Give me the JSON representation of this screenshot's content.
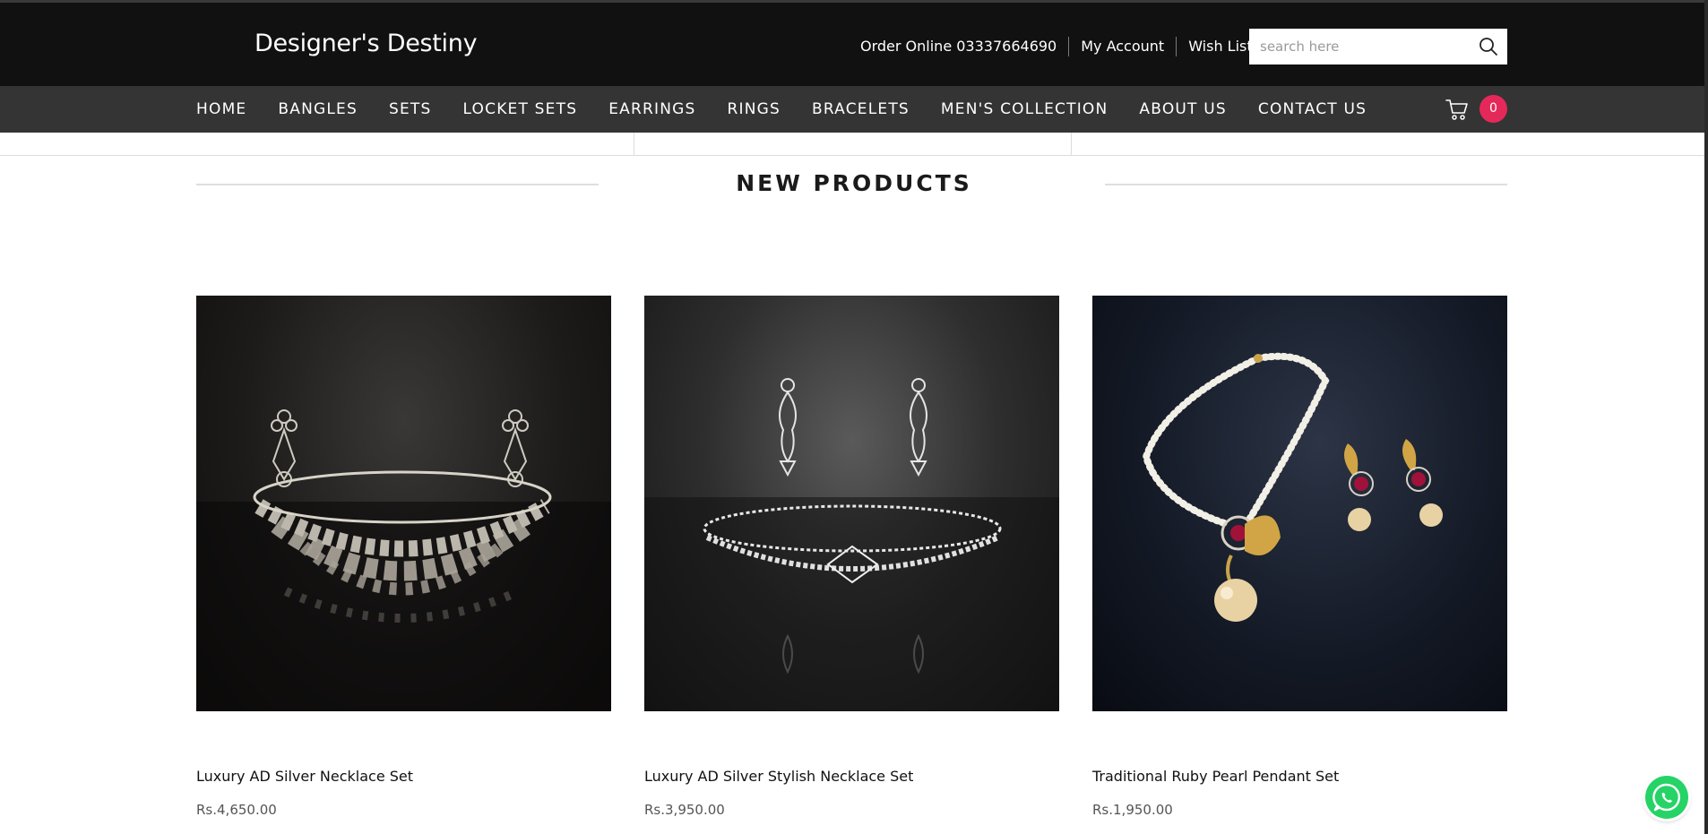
{
  "header": {
    "brand": "Designer's Destiny",
    "order_online": "Order Online 03337664690",
    "my_account": "My Account",
    "wish_lists": "Wish Lists",
    "search_placeholder": "search here"
  },
  "nav": {
    "items": [
      "HOME",
      "BANGLES",
      "SETS",
      "LOCKET SETS",
      "EARRINGS",
      "RINGS",
      "BRACELETS",
      "MEN'S COLLECTION",
      "ABOUT US",
      "CONTACT US"
    ],
    "cart_count": "0"
  },
  "section": {
    "title": "NEW PRODUCTS"
  },
  "products": [
    {
      "name": "Luxury AD Silver Necklace Set",
      "price": "Rs.4,650.00"
    },
    {
      "name": "Luxury AD Silver Stylish Necklace Set",
      "price": "Rs.3,950.00"
    },
    {
      "name": "Traditional Ruby Pearl Pendant Set",
      "price": "Rs.1,950.00"
    }
  ],
  "colors": {
    "header_bg": "#111111",
    "nav_bg": "#343434",
    "badge": "#e5285a",
    "whatsapp": "#25d366"
  },
  "icons": [
    "search-icon",
    "cart-icon",
    "whatsapp-icon"
  ]
}
